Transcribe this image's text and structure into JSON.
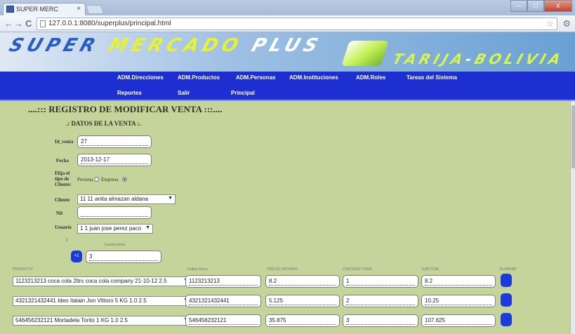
{
  "browser": {
    "tab_title": "SUPER MERC",
    "url": "127.0.0.1:8080/superplus/principal.html",
    "tab_close": "×",
    "back_glyph": "←",
    "forward_glyph": "→",
    "reload_glyph": "C",
    "star_glyph": "☆",
    "wrench_glyph": "⚙",
    "minimize_glyph": "–",
    "maximize_glyph": "□",
    "close_glyph": "x"
  },
  "banner": {
    "title_word1": "SUPER",
    "title_word2": "MERCADO",
    "title_word3": "PLUS",
    "subtitle_left": "TARIJA",
    "subtitle_dash": "-",
    "subtitle_right": "BOLIVIA"
  },
  "menu": {
    "row1": [
      "ADM.Direcciones",
      "ADM.Productos",
      "ADM.Personas",
      "ADM.Instituciones",
      "ADM.Roles",
      "Tareas del Sistema"
    ],
    "row2": [
      "Reportes",
      "Salir",
      "Principal"
    ]
  },
  "form": {
    "heading": "....::: REGISTRO DE MODIFICAR VENTA :::....",
    "subheading": ".: DATOS DE LA VENTA :.",
    "id_venta_label": "Id_venta",
    "id_venta_value": "27",
    "fecha_label": "Fecha",
    "fecha_value": "2013-12-17",
    "tipo_cliente_label_1": "Elija el",
    "tipo_cliente_label_2": "tipo de",
    "tipo_cliente_label_3": "Cliente:",
    "radio_persona_label": "Persona",
    "radio_empresa_label": "Empresa",
    "cliente_label": "Cliente",
    "cliente_value": "11 11 anita almazan aldana",
    "nit_label": "Nit",
    "nit_value": "",
    "usuario_label": "Usuario",
    "usuario_value": "1 1 juan jose perez paco",
    "colon": ":",
    "cantidad_label": "Cantidad Items",
    "add_item_label": "+1",
    "cantidad_value": "3"
  },
  "items": {
    "headers": [
      "PRODUCTO",
      "Codigo Barra",
      "PRECIO UNITARIO",
      "CANTIDAD ITEMS",
      "SUBTOTAL",
      "ELIMINAR"
    ],
    "rows": [
      {
        "producto": "1123213213 coca cola 2ltrs coca cola company 21-10-12 2.5",
        "codigo": "1123213213",
        "precio": "8.2",
        "cantidad": "1",
        "subtotal": "8.2"
      },
      {
        "producto": "4321321432441 Ideo Italain Jon Vittoro 5 KG 1.0 2.5",
        "codigo": "4321321432441",
        "precio": "5.125",
        "cantidad": "2",
        "subtotal": "10.25"
      },
      {
        "producto": "546456232121 Mortadela Torito 1 KG 1.0 2.5",
        "codigo": "546456232121",
        "precio": "35.875",
        "cantidad": "3",
        "subtotal": "107.625"
      }
    ]
  },
  "colors": {
    "menu_bg": "#1d2fd0",
    "content_bg": "#c4d49a",
    "button_blue": "#1d3bdc"
  }
}
